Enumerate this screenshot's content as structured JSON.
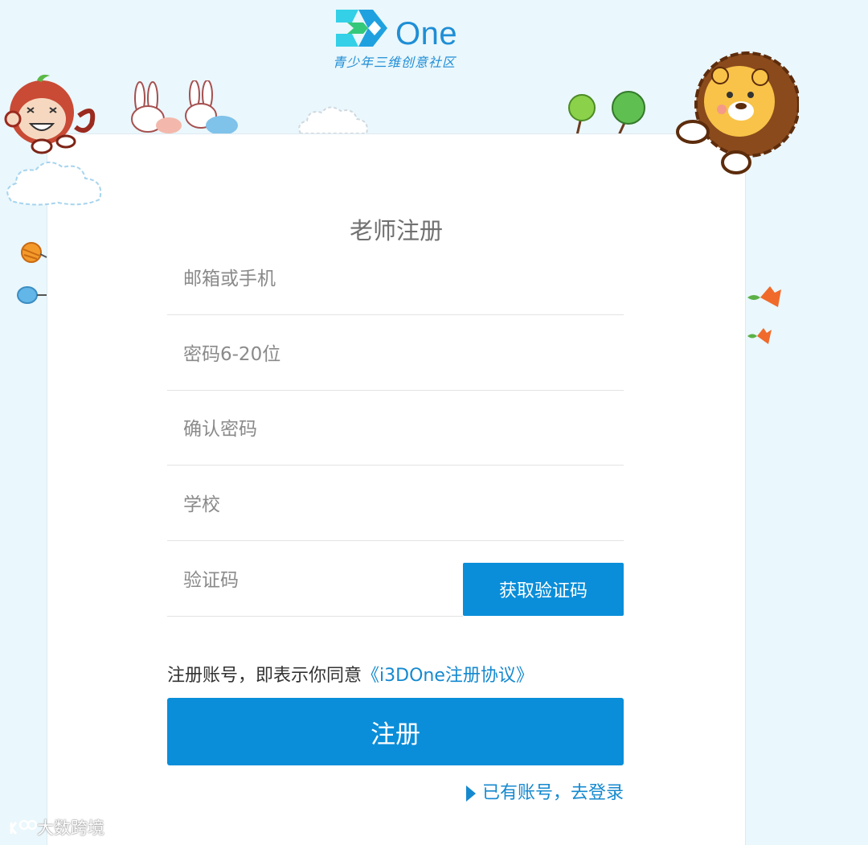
{
  "logo": {
    "word": "One",
    "subtitle": "青少年三维创意社区"
  },
  "form": {
    "title": "老师注册",
    "fields": {
      "account": {
        "placeholder": "邮箱或手机",
        "value": ""
      },
      "password": {
        "placeholder": "密码6-20位",
        "value": ""
      },
      "confirm": {
        "placeholder": "确认密码",
        "value": ""
      },
      "school": {
        "placeholder": "学校",
        "value": ""
      },
      "code": {
        "placeholder": "验证码",
        "value": ""
      }
    },
    "get_code_label": "获取验证码",
    "agreement_prefix": "注册账号，即表示你同意",
    "agreement_link": "《i3DOne注册协议》",
    "register_label": "注册",
    "login_link": "已有账号，去登录"
  },
  "watermark": "大数跨境",
  "colors": {
    "accent": "#0a8ed9",
    "link": "#1589cf",
    "background": "#eaf7fc"
  }
}
